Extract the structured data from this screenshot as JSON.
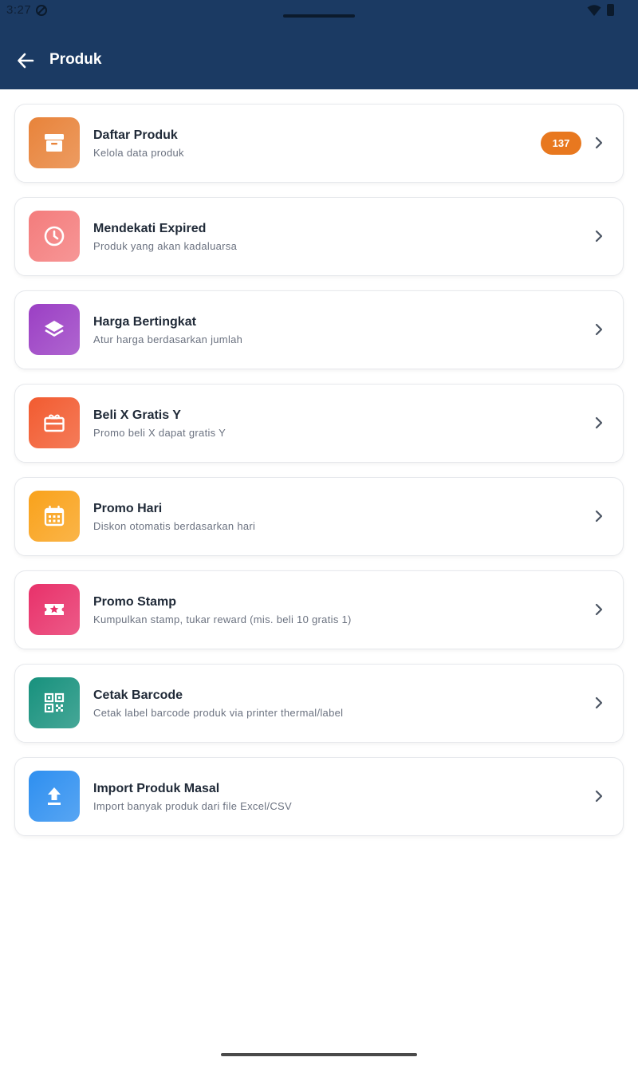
{
  "status_bar": {
    "time": "3:27",
    "dnd_icon": "do-not-disturb-icon",
    "wifi_icon": "wifi-icon",
    "battery_icon": "battery-icon"
  },
  "header": {
    "back_icon": "arrow-left-icon",
    "title": "Produk",
    "background": "#1b3a63"
  },
  "menu": [
    {
      "title": "Daftar Produk",
      "subtitle": "Kelola data produk",
      "badge": "137",
      "icon": "archive-box-icon",
      "color": "#e8833a"
    },
    {
      "title": "Mendekati Expired",
      "subtitle": "Produk yang akan kadaluarsa",
      "badge": null,
      "icon": "clock-icon",
      "color": "#f47c7c"
    },
    {
      "title": "Harga Bertingkat",
      "subtitle": "Atur harga berdasarkan jumlah",
      "badge": null,
      "icon": "layers-icon",
      "color": "#9b3fc4"
    },
    {
      "title": "Beli X Gratis Y",
      "subtitle": "Promo beli X dapat gratis Y",
      "badge": null,
      "icon": "gift-card-icon",
      "color": "#f25b30"
    },
    {
      "title": "Promo Hari",
      "subtitle": "Diskon otomatis berdasarkan hari",
      "badge": null,
      "icon": "calendar-icon",
      "color": "#f9a21b"
    },
    {
      "title": "Promo Stamp",
      "subtitle": "Kumpulkan stamp, tukar reward (mis. beli 10 gratis 1)",
      "badge": null,
      "icon": "star-ticket-icon",
      "color": "#e8316a"
    },
    {
      "title": "Cetak Barcode",
      "subtitle": "Cetak label barcode produk via printer thermal/label",
      "badge": null,
      "icon": "qr-code-icon",
      "color": "#17917d"
    },
    {
      "title": "Import Produk Masal",
      "subtitle": "Import banyak produk dari file Excel/CSV",
      "badge": null,
      "icon": "upload-icon",
      "color": "#2e8ff0"
    }
  ]
}
